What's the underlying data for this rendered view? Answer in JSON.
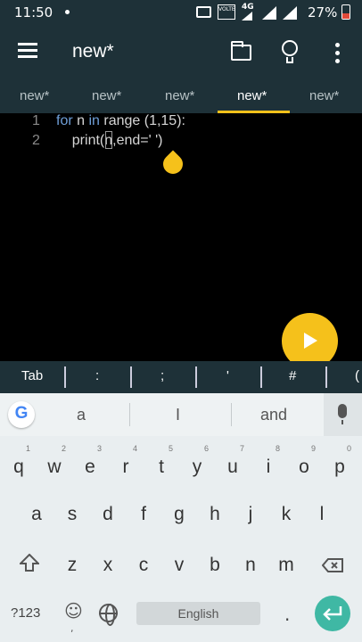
{
  "status": {
    "time": "11:50",
    "volte": "VOLTE",
    "network": "4G",
    "battery": "27%"
  },
  "appbar": {
    "title": "new*",
    "icons": [
      "menu-icon",
      "folder-icon",
      "lightbulb-icon",
      "more-vert-icon"
    ]
  },
  "tabs": [
    {
      "label": "new*",
      "active": false
    },
    {
      "label": "new*",
      "active": false
    },
    {
      "label": "new*",
      "active": false
    },
    {
      "label": "new*",
      "active": true
    },
    {
      "label": "new*",
      "active": false
    }
  ],
  "editor": {
    "lines": [
      {
        "number": "1",
        "kw1": "for",
        "t1": " n ",
        "kw2": "in",
        "t2": " range (1,15):"
      },
      {
        "number": "2",
        "code": "    print(n,end=' ')"
      }
    ]
  },
  "run_button": {
    "icon": "play-icon"
  },
  "symbols": [
    "Tab",
    ":",
    ";",
    "'",
    "#",
    "("
  ],
  "keyboard": {
    "suggestions": [
      "a",
      "I",
      "and"
    ],
    "row1": [
      {
        "key": "q",
        "hint": "1"
      },
      {
        "key": "w",
        "hint": "2"
      },
      {
        "key": "e",
        "hint": "3"
      },
      {
        "key": "r",
        "hint": "4"
      },
      {
        "key": "t",
        "hint": "5"
      },
      {
        "key": "y",
        "hint": "6"
      },
      {
        "key": "u",
        "hint": "7"
      },
      {
        "key": "i",
        "hint": "8"
      },
      {
        "key": "o",
        "hint": "9"
      },
      {
        "key": "p",
        "hint": "0"
      }
    ],
    "row2": [
      "a",
      "s",
      "d",
      "f",
      "g",
      "h",
      "j",
      "k",
      "l"
    ],
    "row3": [
      "z",
      "x",
      "c",
      "v",
      "b",
      "n",
      "m"
    ],
    "numbers_key": "?123",
    "emoji_comma": ",",
    "space_label": "English",
    "period": ".",
    "accent": "#3fb8a4"
  }
}
